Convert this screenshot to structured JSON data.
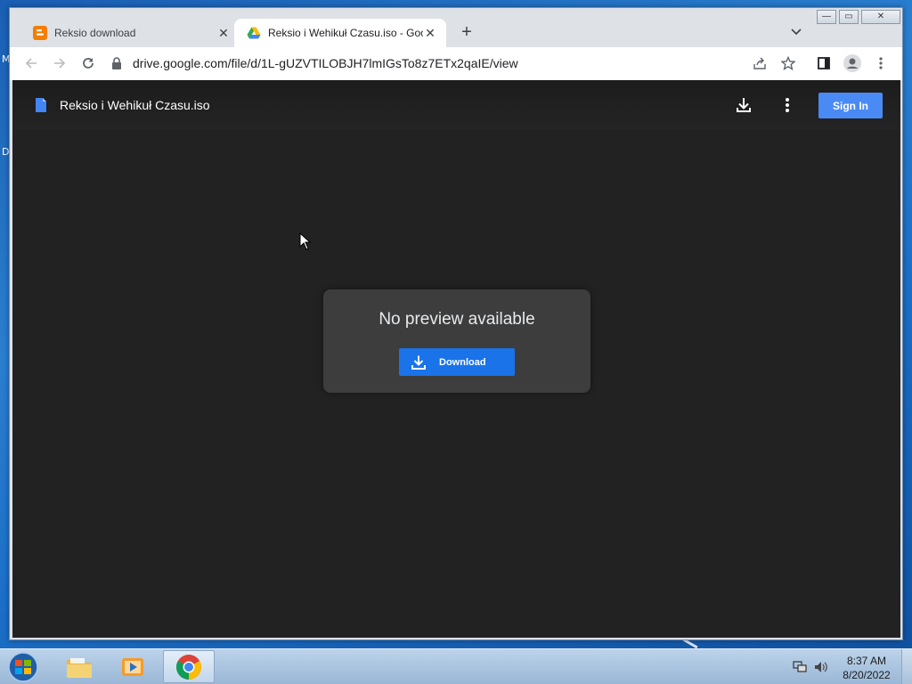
{
  "desktop": {
    "left_letters": [
      "M",
      "D"
    ]
  },
  "browser": {
    "tabs": [
      {
        "title": "Reksio download",
        "icon": "blogger-icon",
        "active": false
      },
      {
        "title": "Reksio i Wehikuł Czasu.iso - Goo",
        "icon": "google-drive-icon",
        "active": true
      }
    ],
    "window_controls": {
      "minimize": "—",
      "maximize": "▭",
      "close": "✕"
    },
    "url": "drive.google.com/file/d/1L-gUZVTILOBJH7lmIGsTo8z7ETx2qaIE/view"
  },
  "drive": {
    "file_name": "Reksio i Wehikuł Czasu.iso",
    "sign_in_label": "Sign In",
    "preview_message": "No preview available",
    "download_label": "Download"
  },
  "taskbar": {
    "time": "8:37 AM",
    "date": "8/20/2022",
    "apps": [
      "windows-explorer",
      "media-player",
      "chrome"
    ]
  },
  "colors": {
    "accent_blue": "#1a73e8",
    "signin_blue": "#4a8af4",
    "page_bg": "#222222",
    "card_bg": "#3d3d3d"
  }
}
